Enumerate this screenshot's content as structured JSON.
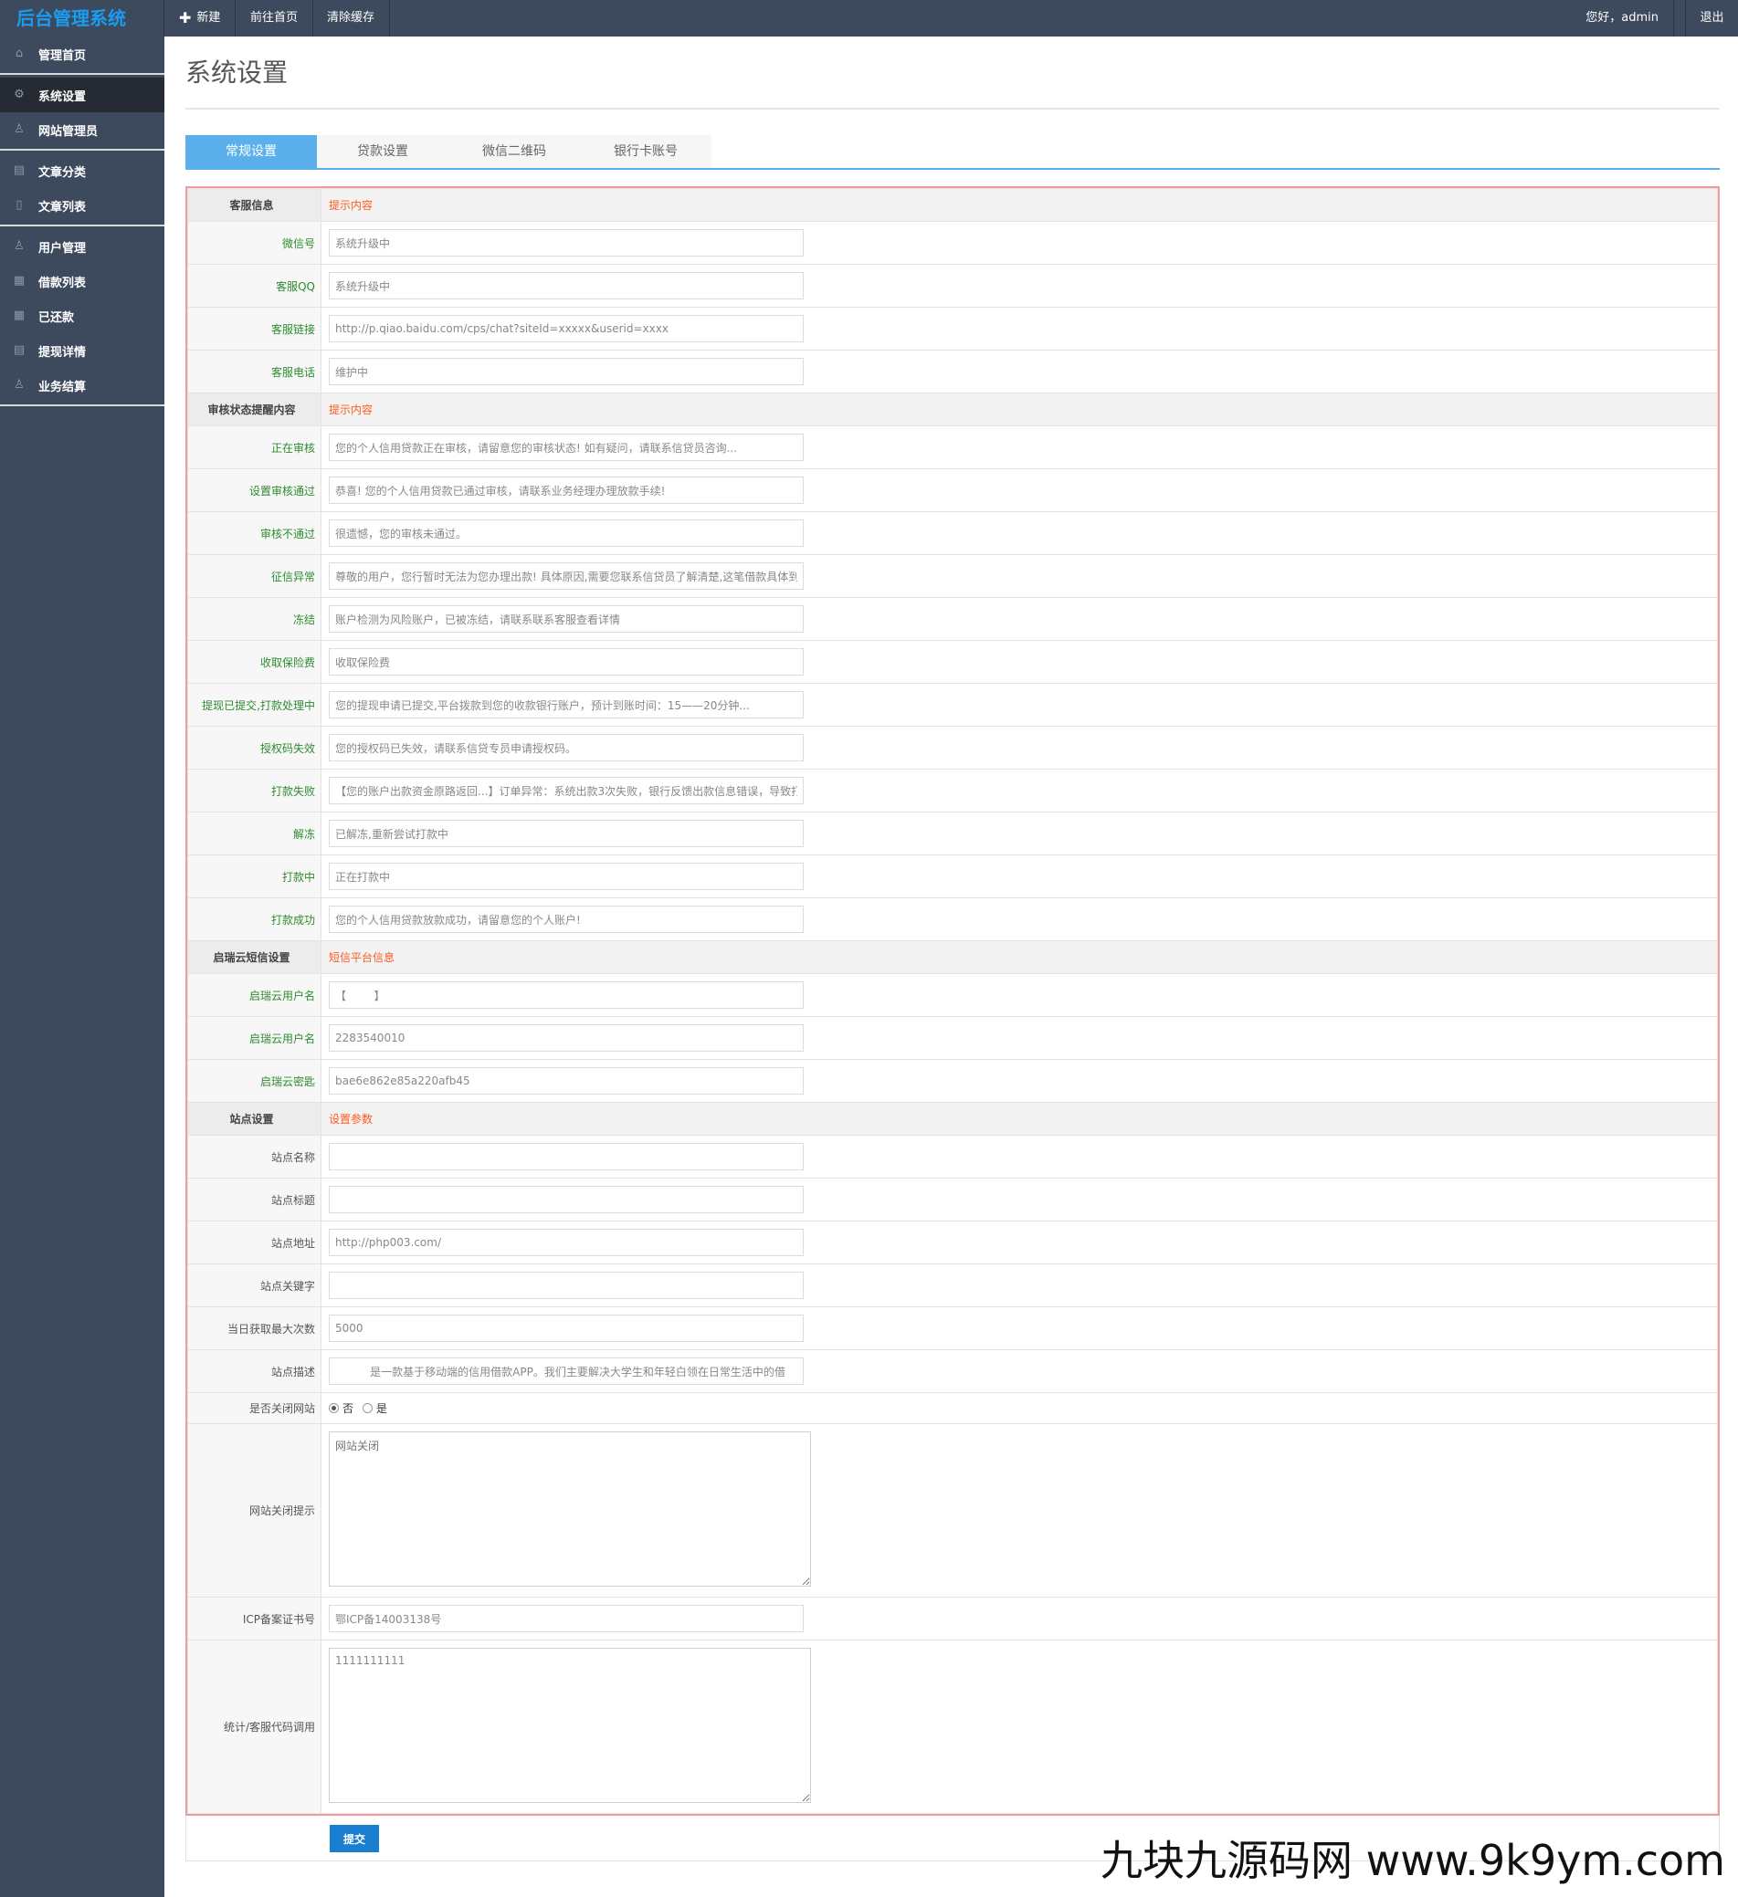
{
  "app": {
    "logo": "后台管理系统"
  },
  "topbar": {
    "new_label": "新建",
    "home_label": "前往首页",
    "clear_label": "清除缓存",
    "greeting": "您好，admin",
    "logout": "退出"
  },
  "sidebar": {
    "items": [
      {
        "label": "管理首页",
        "icon": "home-icon"
      },
      {
        "label": "系统设置",
        "icon": "gear-icon",
        "active": true
      },
      {
        "label": "网站管理员",
        "icon": "user-icon"
      },
      {
        "label": "文章分类",
        "icon": "book-icon"
      },
      {
        "label": "文章列表",
        "icon": "file-icon"
      },
      {
        "label": "用户管理",
        "icon": "users-icon"
      },
      {
        "label": "借款列表",
        "icon": "grid-icon"
      },
      {
        "label": "已还款",
        "icon": "grid-icon"
      },
      {
        "label": "提现详情",
        "icon": "list-icon"
      },
      {
        "label": "业务结算",
        "icon": "users-icon"
      }
    ]
  },
  "page": {
    "title": "系统设置"
  },
  "tabs": [
    "常规设置",
    "贷款设置",
    "微信二维码",
    "银行卡账号"
  ],
  "sections": {
    "s1": {
      "label": "客服信息",
      "hint": "提示内容"
    },
    "s2": {
      "label": "审核状态提醒内容",
      "hint": "提示内容"
    },
    "s3": {
      "label": "启瑞云短信设置",
      "hint": "短信平台信息"
    },
    "s4": {
      "label": "站点设置",
      "hint": "设置参数"
    }
  },
  "fields": {
    "wechat": {
      "label": "微信号",
      "value": "系统升级中"
    },
    "qq": {
      "label": "客服QQ",
      "value": "系统升级中"
    },
    "link": {
      "label": "客服链接",
      "value": "http://p.qiao.baidu.com/cps/chat?siteId=xxxxx&userid=xxxx"
    },
    "phone": {
      "label": "客服电话",
      "value": "维护中"
    },
    "reviewing": {
      "label": "正在审核",
      "value": "您的个人信用贷款正在审核，请留意您的审核状态! 如有疑问，请联系信贷员咨询..."
    },
    "passed": {
      "label": "设置审核通过",
      "value": "恭喜! 您的个人信用贷款已通过审核，请联系业务经理办理放款手续!"
    },
    "rejected": {
      "label": "审核不通过",
      "value": "很遗憾，您的审核未通过。"
    },
    "credit": {
      "label": "征信异常",
      "value": "尊敬的用户，您行暂时无法为您办理出款! 具体原因,需要您联系信贷员了解清楚,这笔借款具体到"
    },
    "frozen": {
      "label": "冻结",
      "value": "账户检测为风险账户，已被冻结，请联系联系客服查看详情"
    },
    "insurance": {
      "label": "收取保险费",
      "value": "收取保险费"
    },
    "withdraw": {
      "label": "提现已提交,打款处理中",
      "value": "您的提现申请已提交,平台拨款到您的收款银行账户，预计到账时间：15——20分钟..."
    },
    "authfail": {
      "label": "授权码失效",
      "value": "您的授权码已失效，请联系信贷专员申请授权码。"
    },
    "payfail": {
      "label": "打款失败",
      "value": "【您的账户出款资金原路返回...】订单异常：系统出款3次失败，银行反馈出款信息错误，导致打"
    },
    "unfreeze": {
      "label": "解冻",
      "value": "已解冻,重新尝试打款中"
    },
    "paying": {
      "label": "打款中",
      "value": "正在打款中"
    },
    "paid": {
      "label": "打款成功",
      "value": "您的个人信用贷款放款成功，请留意您的个人账户!"
    },
    "smsuser": {
      "label": "启瑞云用户名",
      "value": "【        】"
    },
    "smsuser2": {
      "label": "启瑞云用户名",
      "value": "2283540010"
    },
    "smskey": {
      "label": "启瑞云密匙",
      "value": "bae6e862e85a220afb45"
    },
    "sitename": {
      "label": "站点名称",
      "value": ""
    },
    "sitetitle": {
      "label": "站点标题",
      "value": ""
    },
    "siteurl": {
      "label": "站点地址",
      "value": "http://php003.com/"
    },
    "sitekw": {
      "label": "站点关键字",
      "value": ""
    },
    "maxcount": {
      "label": "当日获取最大次数",
      "value": "5000"
    },
    "sitedesc": {
      "label": "站点描述",
      "value": "          是一款基于移动端的信用借款APP。我们主要解决大学生和年轻白领在日常生活中的借"
    },
    "closesite": {
      "label": "是否关闭网站",
      "no": "否",
      "yes": "是"
    },
    "closetip": {
      "label": "网站关闭提示",
      "placeholder": "网站关闭"
    },
    "icp": {
      "label": "ICP备案证书号",
      "value": "鄂ICP备14003138号"
    },
    "stats": {
      "label": "统计/客服代码调用",
      "value": "1111111111"
    }
  },
  "submit": "提交",
  "watermark": "九块九源码网 www.9k9ym.com"
}
